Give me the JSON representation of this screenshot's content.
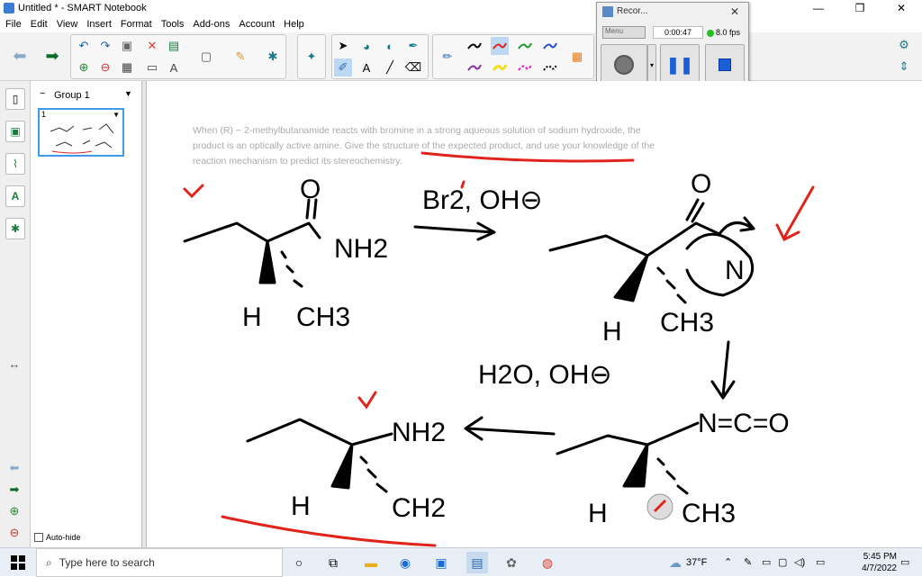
{
  "window": {
    "title": "Untitled * - SMART Notebook",
    "minimize": "—",
    "maximize": "❐",
    "close": "✕"
  },
  "menu": [
    "File",
    "Edit",
    "View",
    "Insert",
    "Format",
    "Tools",
    "Add-ons",
    "Account",
    "Help"
  ],
  "pages_panel": {
    "group_label": "Group 1",
    "page_number": "1",
    "auto_hide_label": "Auto-hide"
  },
  "question": {
    "text": "When (R) − 2-methylbutanamide reacts with bromine in a strong aqueous solution of sodium hydroxide, the product is an optically active amine. Give the structure of the expected product, and use your knowledge of the reaction mechanism to predict its stereochemistry."
  },
  "recorder": {
    "title": "Recor...",
    "close": "✕",
    "select_value": "Menu",
    "time": "0:00:47",
    "fps": "8.0 fps"
  },
  "handwriting": {
    "reagent_top": "Br2, OH⊖",
    "amide_label": "NH2",
    "h_label_1": "H",
    "ch3_label_1": "CH3",
    "o_label_1": "O",
    "o_label_2": "O",
    "h_label_2": "H",
    "ch3_label_2": "CH3",
    "n_label": "N",
    "reagent_mid": "H2O, OH⊖",
    "isocyanate": "N=C=O",
    "amine_label": "NH2",
    "h_label_3": "H",
    "ch3_label_3": "CH2",
    "h_label_4": "H",
    "ch3_label_4": "CH3"
  },
  "taskbar": {
    "search_placeholder": "Type here to search",
    "weather": "37°F",
    "time": "5:45 PM",
    "date": "4/7/2022"
  },
  "colors": {
    "accent": "#3d9be9",
    "ink": "#000000",
    "annotation": "#e0241b",
    "record_green": "#22c122"
  }
}
